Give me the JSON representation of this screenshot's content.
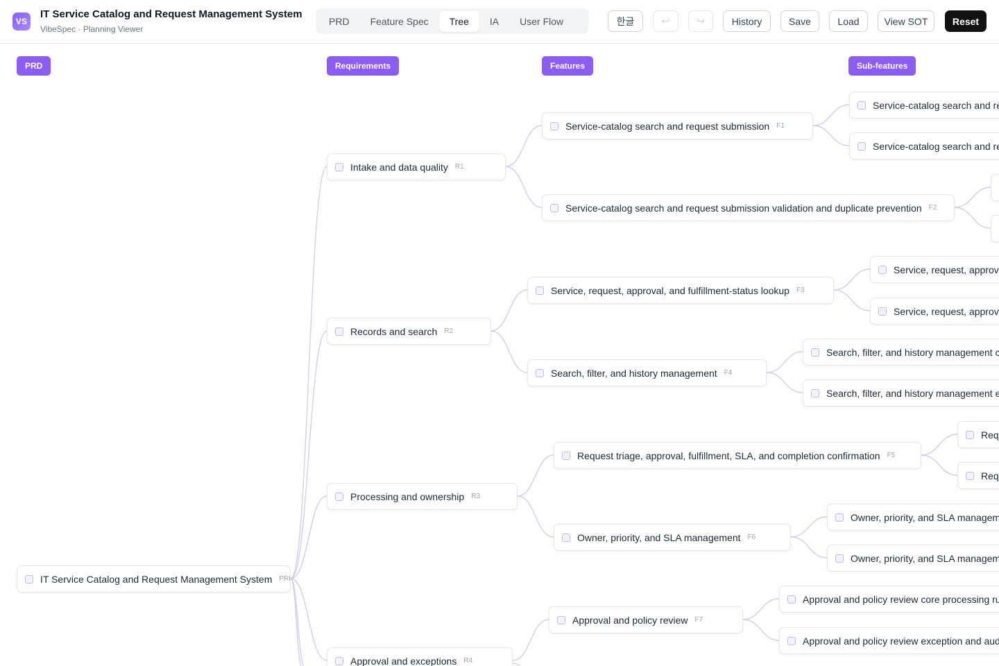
{
  "app": {
    "logo_text": "VS",
    "title": "IT Service Catalog and Request Management System",
    "subtitle": "VibeSpec · Planning Viewer"
  },
  "tabs": [
    {
      "label": "PRD",
      "active": false
    },
    {
      "label": "Feature Spec",
      "active": false
    },
    {
      "label": "Tree",
      "active": true
    },
    {
      "label": "IA",
      "active": false
    },
    {
      "label": "User Flow",
      "active": false
    }
  ],
  "toolbar": {
    "language": "한글",
    "undo_icon": "↩",
    "redo_icon": "↪",
    "history": "History",
    "save": "Save",
    "load": "Load",
    "view_sot": "View SOT",
    "reset": "Reset"
  },
  "columns": {
    "prd": "PRD",
    "requirements": "Requirements",
    "features": "Features",
    "subfeatures": "Sub-features"
  },
  "tree": {
    "root": {
      "label": "IT Service Catalog and Request Management System",
      "code": "PRD"
    },
    "requirements": [
      {
        "label": "Intake and data quality",
        "code": "R1"
      },
      {
        "label": "Records and search",
        "code": "R2"
      },
      {
        "label": "Processing and ownership",
        "code": "R3"
      },
      {
        "label": "Approval and exceptions",
        "code": "R4"
      }
    ],
    "features": [
      {
        "label": "Service-catalog search and request submission",
        "code": "F1"
      },
      {
        "label": "Service-catalog search and request submission validation and duplicate prevention",
        "code": "F2"
      },
      {
        "label": "Service, request, approval, and fulfillment-status lookup",
        "code": "F3"
      },
      {
        "label": "Search, filter, and history management",
        "code": "F4"
      },
      {
        "label": "Request triage, approval, fulfillment, SLA, and completion confirmation",
        "code": "F5"
      },
      {
        "label": "Owner, priority, and SLA management",
        "code": "F6"
      },
      {
        "label": "Approval and policy review",
        "code": "F7"
      }
    ],
    "subfeatures": [
      {
        "label": "Service-catalog search and requ"
      },
      {
        "label": "Service-catalog search and requ"
      },
      {
        "label": ""
      },
      {
        "label": ""
      },
      {
        "label": "Service, request, approval,"
      },
      {
        "label": "Service, request, approval,"
      },
      {
        "label": "Search, filter, and history management core"
      },
      {
        "label": "Search, filter, and history management excep"
      },
      {
        "label": "Requ"
      },
      {
        "label": "Requ"
      },
      {
        "label": "Owner, priority, and SLA management"
      },
      {
        "label": "Owner, priority, and SLA management"
      },
      {
        "label": "Approval and policy review core processing rule"
      },
      {
        "label": "Approval and policy review exception and audit ha"
      }
    ]
  },
  "colors": {
    "accent": "#8b5cf6",
    "edge": "#d4ccf0",
    "reset_bg": "#111111"
  }
}
